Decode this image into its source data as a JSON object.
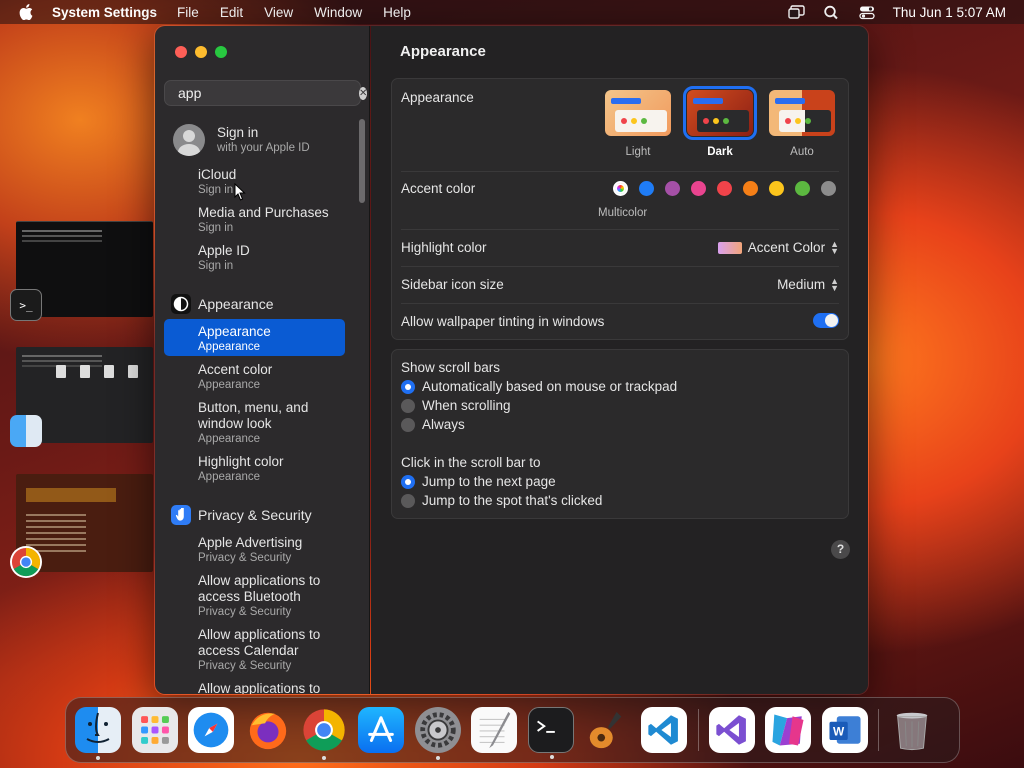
{
  "menubar": {
    "app_name": "System Settings",
    "menus": [
      "File",
      "Edit",
      "View",
      "Window",
      "Help"
    ],
    "clock": "Thu Jun 1  5:07 AM"
  },
  "search": {
    "value": "app"
  },
  "sidebar": {
    "signin": {
      "title": "Sign in",
      "subtitle": "with your Apple ID"
    },
    "results": [
      {
        "title": "iCloud",
        "subtitle": "Sign in"
      },
      {
        "title": "Media and Purchases",
        "subtitle": "Sign in"
      },
      {
        "title": "Apple ID",
        "subtitle": "Sign in"
      }
    ],
    "appearance_section": "Appearance",
    "appearance_items": [
      {
        "title": "Appearance",
        "subtitle": "Appearance"
      },
      {
        "title": "Accent color",
        "subtitle": "Appearance"
      },
      {
        "title": "Button, menu, and window look",
        "subtitle": "Appearance"
      },
      {
        "title": "Highlight color",
        "subtitle": "Appearance"
      }
    ],
    "privacy_section": "Privacy & Security",
    "privacy_items": [
      {
        "title": "Apple Advertising",
        "subtitle": "Privacy & Security"
      },
      {
        "title": "Allow applications to access Bluetooth",
        "subtitle": "Privacy & Security"
      },
      {
        "title": "Allow applications to access Calendar",
        "subtitle": "Privacy & Security"
      },
      {
        "title": "Allow applications to",
        "subtitle": ""
      }
    ]
  },
  "main": {
    "title": "Appearance",
    "appearance_label": "Appearance",
    "themes": [
      {
        "name": "Light",
        "selected": false
      },
      {
        "name": "Dark",
        "selected": true
      },
      {
        "name": "Auto",
        "selected": false
      }
    ],
    "accent_label": "Accent color",
    "accent_colors": [
      "multicolor",
      "#1f7cf5",
      "#a550a7",
      "#e9448f",
      "#f0434a",
      "#f57f17",
      "#fcc51c",
      "#5cb840",
      "#8c8c8c"
    ],
    "accent_selected_name": "Multicolor",
    "highlight_label": "Highlight color",
    "highlight_value": "Accent Color",
    "sidebar_icon_label": "Sidebar icon size",
    "sidebar_icon_value": "Medium",
    "wallpaper_tint_label": "Allow wallpaper tinting in windows",
    "wallpaper_tint_on": true,
    "scroll_bars_label": "Show scroll bars",
    "scroll_bar_options": [
      {
        "label": "Automatically based on mouse or trackpad",
        "selected": true
      },
      {
        "label": "When scrolling",
        "selected": false
      },
      {
        "label": "Always",
        "selected": false
      }
    ],
    "click_label": "Click in the scroll bar to",
    "click_options": [
      {
        "label": "Jump to the next page",
        "selected": true
      },
      {
        "label": "Jump to the spot that's clicked",
        "selected": false
      }
    ],
    "help_glyph": "?"
  },
  "dock": {
    "apps": [
      "Finder",
      "Launchpad",
      "Safari",
      "Firefox",
      "Chrome",
      "App Store",
      "System Settings",
      "TextEdit",
      "Terminal",
      "GarageBand",
      "Visual Studio Code",
      "Visual Studio",
      "Rider",
      "Word",
      "Trash"
    ]
  }
}
